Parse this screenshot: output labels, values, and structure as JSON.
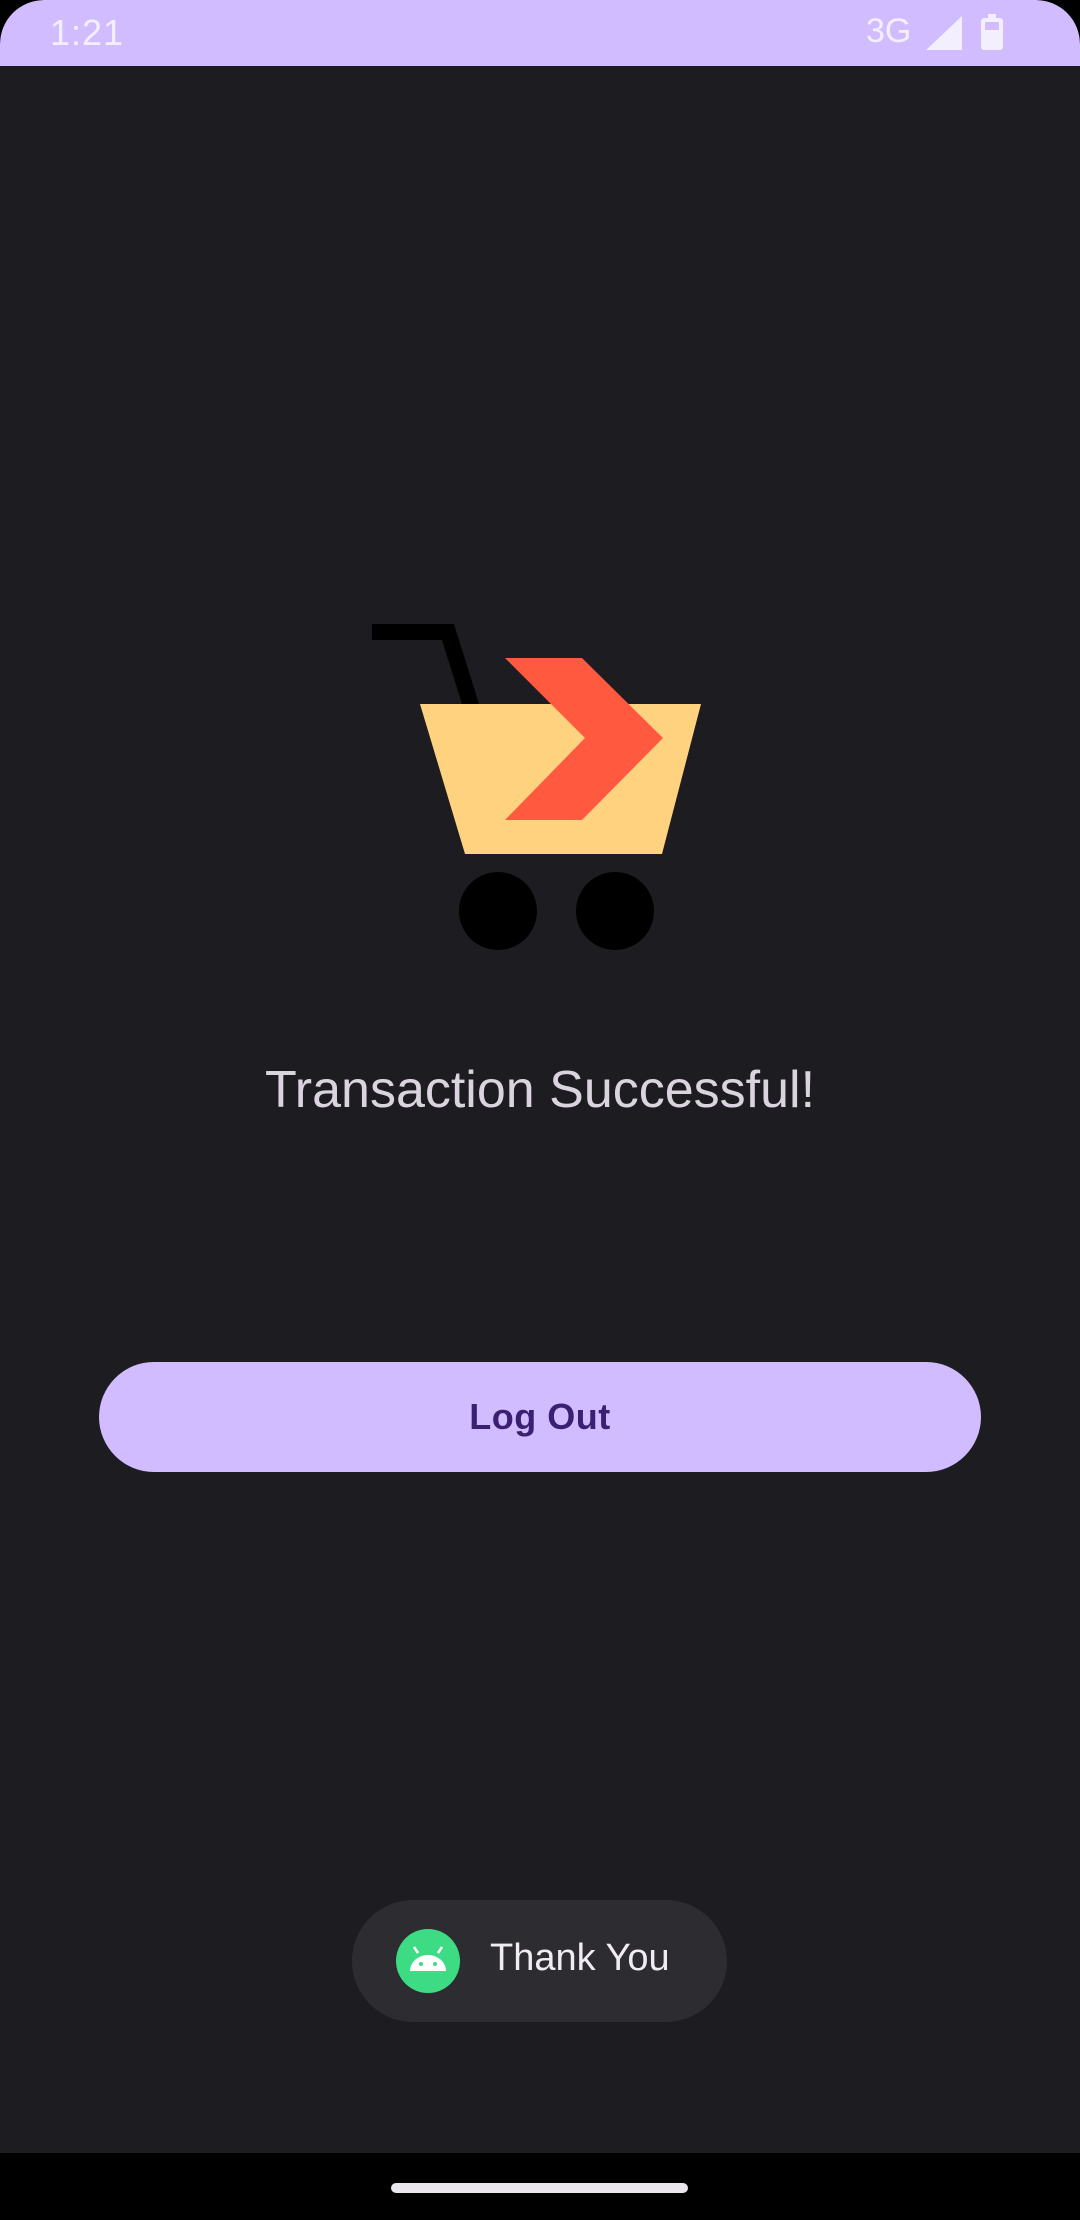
{
  "status_bar": {
    "time": "1:21",
    "network": "3G",
    "icons": [
      "signal-icon",
      "battery-icon"
    ],
    "background": "#d0bcfe"
  },
  "main": {
    "illustration": "shopping-cart-icon",
    "message": "Transaction Successful!",
    "logout_label": "Log Out"
  },
  "toast": {
    "icon": "android-icon",
    "text": "Thank You"
  },
  "colors": {
    "background": "#1d1c21",
    "accent": "#d0bcfe",
    "button_text": "#3a1f72",
    "cart_basket": "#ffd27f",
    "cart_arrow": "#ff5a3f"
  }
}
